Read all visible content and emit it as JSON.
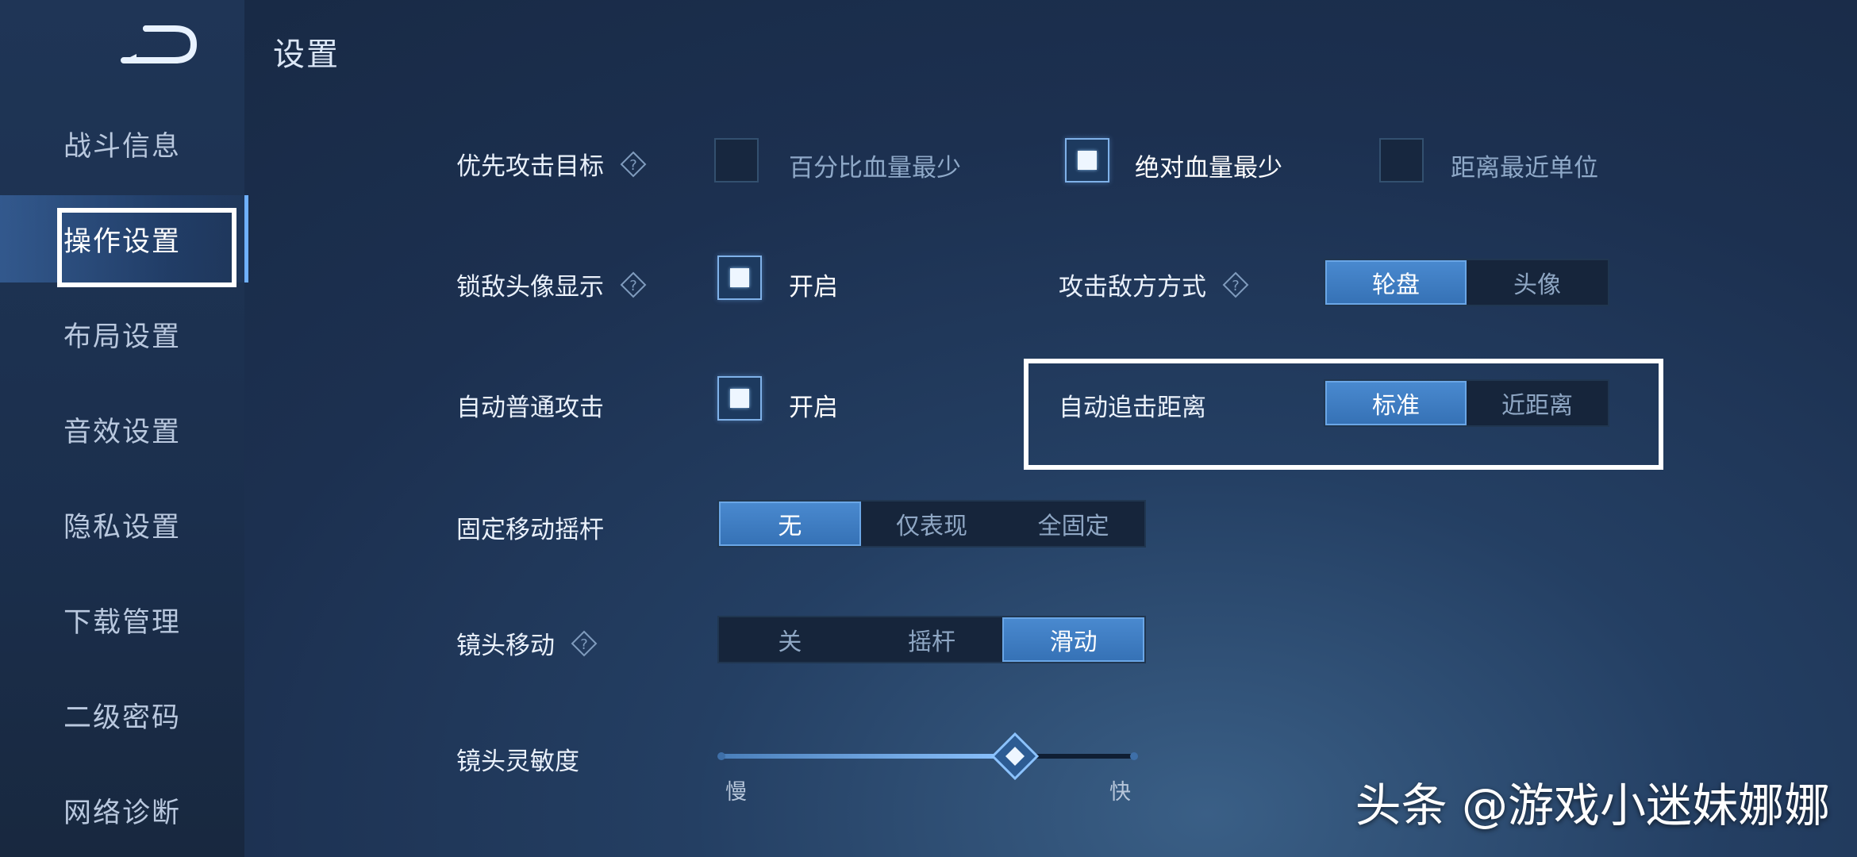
{
  "header": {
    "title": "设置"
  },
  "sidebar": {
    "items": [
      {
        "label": "战斗信息"
      },
      {
        "label": "操作设置",
        "active": true
      },
      {
        "label": "布局设置"
      },
      {
        "label": "音效设置"
      },
      {
        "label": "隐私设置"
      },
      {
        "label": "下载管理"
      },
      {
        "label": "二级密码"
      },
      {
        "label": "网络诊断"
      }
    ]
  },
  "settings": {
    "attack_target": {
      "label": "优先攻击目标",
      "options": [
        "百分比血量最少",
        "绝对血量最少",
        "距离最近单位"
      ],
      "selected": "绝对血量最少"
    },
    "lock_avatar": {
      "label": "锁敌头像显示",
      "checkbox_label": "开启",
      "checked": true
    },
    "attack_mode": {
      "label": "攻击敌方方式",
      "options": [
        "轮盘",
        "头像"
      ],
      "selected": "轮盘"
    },
    "auto_attack": {
      "label": "自动普通攻击",
      "checkbox_label": "开启",
      "checked": true
    },
    "chase_distance": {
      "label": "自动追击距离",
      "options": [
        "标准",
        "近距离"
      ],
      "selected": "标准"
    },
    "fixed_joystick": {
      "label": "固定移动摇杆",
      "options": [
        "无",
        "仅表现",
        "全固定"
      ],
      "selected": "无"
    },
    "camera_move": {
      "label": "镜头移动",
      "options": [
        "关",
        "摇杆",
        "滑动"
      ],
      "selected": "滑动"
    },
    "camera_sensitivity": {
      "label": "镜头灵敏度",
      "min_label": "慢",
      "max_label": "快",
      "value": 0.71
    }
  },
  "watermark": {
    "text": "头条 @游戏小迷妹娜娜"
  },
  "colors": {
    "accent": "#3f7fc4",
    "highlight_box": "#ffffff",
    "background": "#1c3050"
  },
  "icons": {
    "back": "back-arrow-icon",
    "help": "question-diamond-icon",
    "slider_knob": "diamond-knob-icon"
  }
}
